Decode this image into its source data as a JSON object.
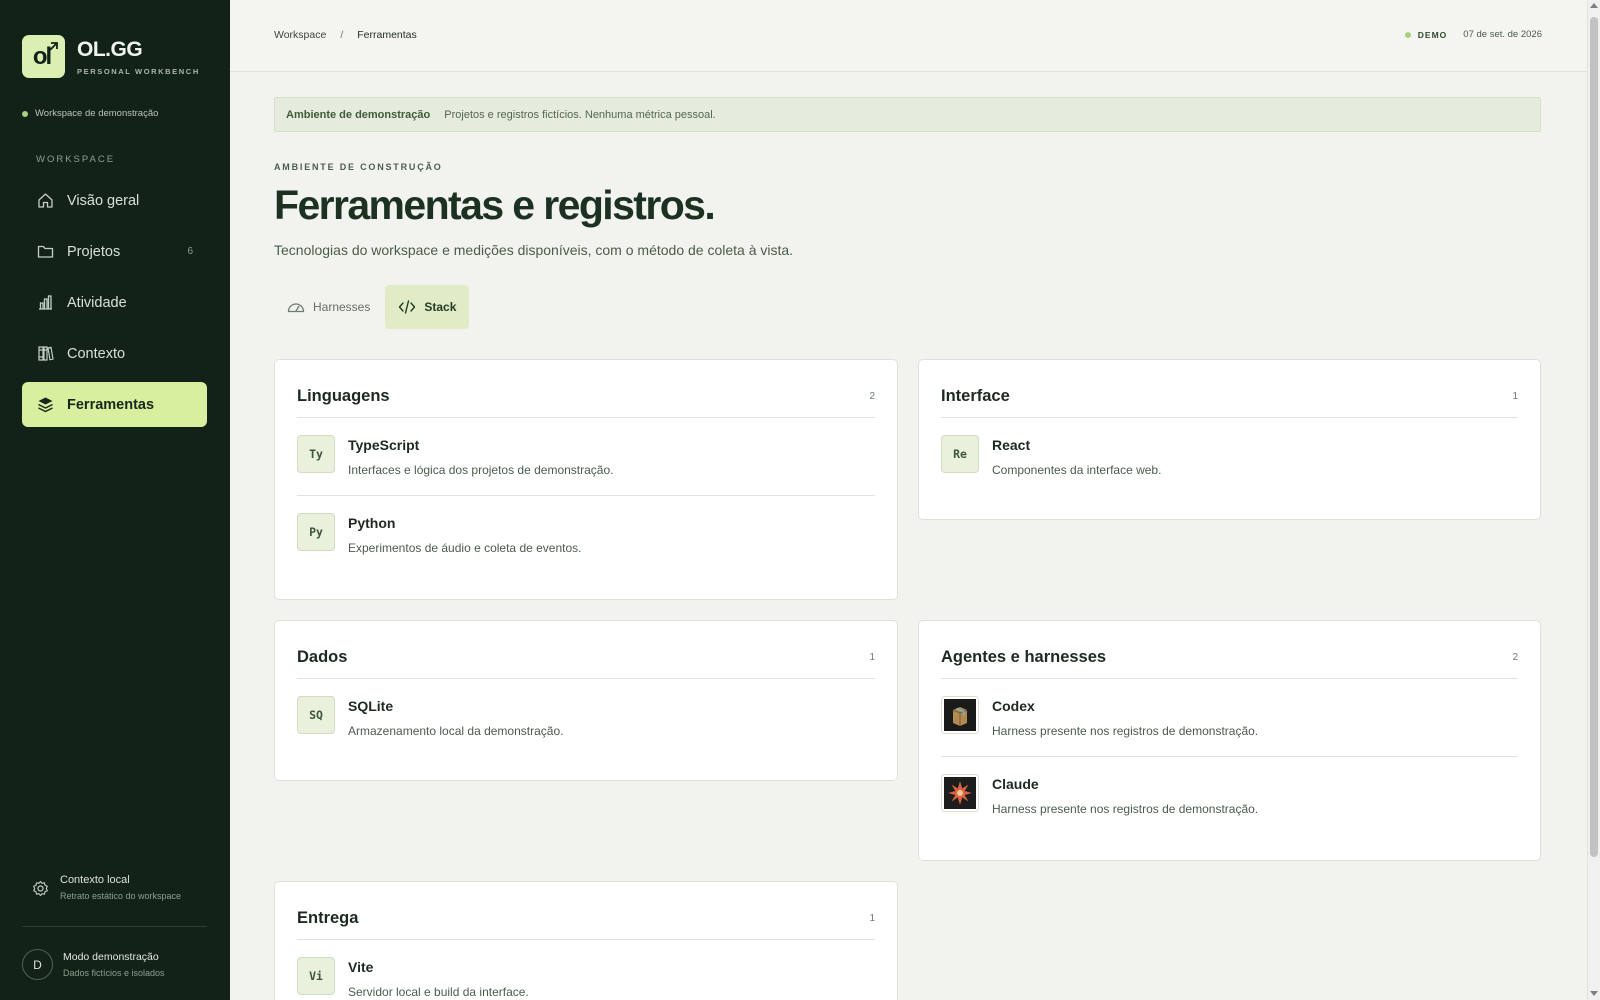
{
  "brand": {
    "logo_text": "ol",
    "name": "OL.GG",
    "tagline": "PERSONAL WORKBENCH"
  },
  "workspace_status": "Workspace de demonstração",
  "sidebar": {
    "heading": "WORKSPACE",
    "items": [
      {
        "label": "Visão geral",
        "icon": "home-icon"
      },
      {
        "label": "Projetos",
        "icon": "folder-icon",
        "count": "6"
      },
      {
        "label": "Atividade",
        "icon": "bar-chart-icon"
      },
      {
        "label": "Contexto",
        "icon": "books-icon"
      },
      {
        "label": "Ferramentas",
        "icon": "layers-icon",
        "active": true
      }
    ],
    "context": {
      "title": "Contexto local",
      "subtitle": "Retrato estático do workspace",
      "icon": "gear-icon"
    },
    "user": {
      "initial": "D",
      "title": "Modo demonstração",
      "subtitle": "Dados fictícios e isolados"
    }
  },
  "topbar": {
    "breadcrumb": [
      "Workspace",
      "/",
      "Ferramentas"
    ],
    "demo_badge": "DEMO",
    "date": "07 de set. de 2026"
  },
  "banner": {
    "label": "Ambiente de demonstração",
    "text": "Projetos e registros fictícios. Nenhuma métrica pessoal."
  },
  "page": {
    "eyebrow": "AMBIENTE DE CONSTRUÇÃO",
    "title": "Ferramentas e registros.",
    "subtitle": "Tecnologias do workspace e medições disponíveis, com o método de coleta à vista."
  },
  "tabs": [
    {
      "label": "Harnesses",
      "icon": "gauge-icon"
    },
    {
      "label": "Stack",
      "icon": "code-icon",
      "active": true
    }
  ],
  "cards": {
    "linguagens": {
      "title": "Linguagens",
      "count": "2",
      "items": [
        {
          "badge": "Ty",
          "name": "TypeScript",
          "desc": "Interfaces e lógica dos projetos de demonstração."
        },
        {
          "badge": "Py",
          "name": "Python",
          "desc": "Experimentos de áudio e coleta de eventos."
        }
      ]
    },
    "interface": {
      "title": "Interface",
      "count": "1",
      "items": [
        {
          "badge": "Re",
          "name": "React",
          "desc": "Componentes da interface web."
        }
      ]
    },
    "dados": {
      "title": "Dados",
      "count": "1",
      "items": [
        {
          "badge": "SQ",
          "name": "SQLite",
          "desc": "Armazenamento local da demonstração."
        }
      ]
    },
    "agentes": {
      "title": "Agentes e harnesses",
      "count": "2",
      "items": [
        {
          "badge_icon": "codex-icon",
          "name": "Codex",
          "desc": "Harness presente nos registros de demonstração."
        },
        {
          "badge_icon": "claude-icon",
          "name": "Claude",
          "desc": "Harness presente nos registros de demonstração."
        }
      ]
    },
    "entrega": {
      "title": "Entrega",
      "count": "1",
      "items": [
        {
          "badge": "Vi",
          "name": "Vite",
          "desc": "Servidor local e build da interface."
        }
      ]
    }
  },
  "colors": {
    "sidebar_bg": "#132219",
    "accent": "#d8ef9f",
    "page_bg": "#f2f3ee",
    "status_dot": "#a8d080"
  }
}
